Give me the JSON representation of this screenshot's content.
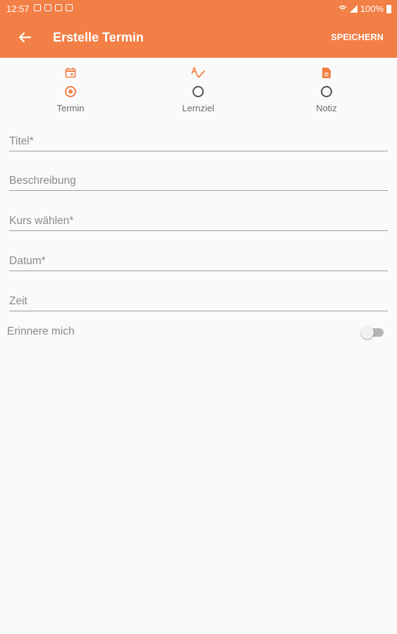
{
  "status_bar": {
    "time": "12:57",
    "battery": "100%",
    "left_icons": [
      "message-icon",
      "notification-icon",
      "calendar-notification-icon",
      "sim-icon"
    ],
    "right_icons": [
      "wifi-icon",
      "signal-icon",
      "battery-icon"
    ]
  },
  "appbar": {
    "title": "Erstelle Termin",
    "save_label": "SPEICHERN",
    "back_icon": "arrow-left-icon",
    "color": "#f27f45"
  },
  "type_options": [
    {
      "label": "Termin",
      "icon": "calendar-icon",
      "selected": true
    },
    {
      "label": "Lernziel",
      "icon": "spellcheck-icon",
      "selected": false
    },
    {
      "label": "Notiz",
      "icon": "note-icon",
      "selected": false
    }
  ],
  "fields": {
    "title": "Titel*",
    "description": "Beschreibung",
    "course": "Kurs wählen*",
    "date": "Datum*",
    "time": "Zeit"
  },
  "reminder": {
    "label": "Erinnere mich",
    "enabled": false
  }
}
